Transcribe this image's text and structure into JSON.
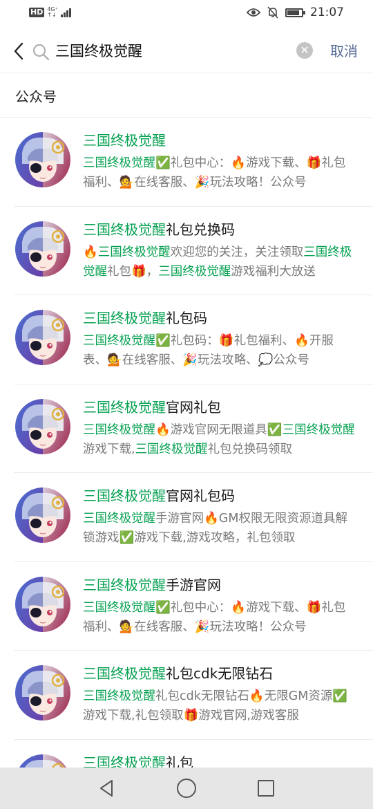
{
  "status": {
    "hd": "HD",
    "net_top": "4G⁺",
    "net_bottom": "↑↓",
    "time": "21:07",
    "battery_level": 0.85
  },
  "search": {
    "query": "三国终极觉醒",
    "cancel_label": "取消"
  },
  "section": {
    "title": "公众号"
  },
  "results": [
    {
      "title": [
        [
          "三国终极觉醒",
          true
        ]
      ],
      "desc": [
        [
          "三国终极觉醒",
          true
        ],
        [
          "✅礼包中心：🔥游戏下载、🎁礼包福利、💁在线客服、🎉玩法攻略！公众号",
          false
        ]
      ]
    },
    {
      "title": [
        [
          "三国终极觉醒",
          true
        ],
        [
          "礼包兑换码",
          false
        ]
      ],
      "desc": [
        [
          "🔥",
          false
        ],
        [
          "三国终极觉醒",
          true
        ],
        [
          "欢迎您的关注，关注领取",
          false
        ],
        [
          "三国终极觉醒",
          true
        ],
        [
          "礼包🎁，",
          false
        ],
        [
          "三国终极觉醒",
          true
        ],
        [
          "游戏福利大放送",
          false
        ]
      ]
    },
    {
      "title": [
        [
          "三国终极觉醒",
          true
        ],
        [
          "礼包码",
          false
        ]
      ],
      "desc": [
        [
          "三国终极觉醒",
          true
        ],
        [
          "✅礼包码：🎁礼包福利、🔥开服表、💁在线客服、🎉玩法攻略、💭公众号",
          false
        ]
      ]
    },
    {
      "title": [
        [
          "三国终极觉醒",
          true
        ],
        [
          "官网礼包",
          false
        ]
      ],
      "desc": [
        [
          "三国终极觉醒",
          true
        ],
        [
          "🔥游戏官网无限道具✅",
          false
        ],
        [
          "三国终极觉醒",
          true
        ],
        [
          "游戏下载,",
          false
        ],
        [
          "三国终极觉醒",
          true
        ],
        [
          "礼包兑换码领取",
          false
        ]
      ]
    },
    {
      "title": [
        [
          "三国终极觉醒",
          true
        ],
        [
          "官网礼包码",
          false
        ]
      ],
      "desc": [
        [
          "三国终极觉醒",
          true
        ],
        [
          "手游官网🔥GM权限无限资源道具解锁游戏✅游戏下载,游戏攻略，礼包领取",
          false
        ]
      ]
    },
    {
      "title": [
        [
          "三国终极觉醒",
          true
        ],
        [
          "手游官网",
          false
        ]
      ],
      "desc": [
        [
          "三国终极觉醒",
          true
        ],
        [
          "✅礼包中心：🔥游戏下载、🎁礼包福利、💁在线客服、🎉玩法攻略！公众号",
          false
        ]
      ]
    },
    {
      "title": [
        [
          "三国终极觉醒",
          true
        ],
        [
          "礼包cdk无限钻石",
          false
        ]
      ],
      "desc": [
        [
          "三国终极觉醒",
          true
        ],
        [
          "礼包cdk无限钻石🔥无限GM资源✅游戏下载,礼包领取🎁游戏官网,游戏客服",
          false
        ]
      ]
    },
    {
      "title": [
        [
          "三国终极觉醒",
          true
        ],
        [
          "礼包",
          false
        ]
      ],
      "desc": []
    }
  ],
  "colors": {
    "highlight": "#07a152",
    "cancel": "#576b95"
  },
  "icons": {
    "back": "chevron-left-icon",
    "search": "magnifier-icon",
    "clear": "clear-circle-icon"
  }
}
